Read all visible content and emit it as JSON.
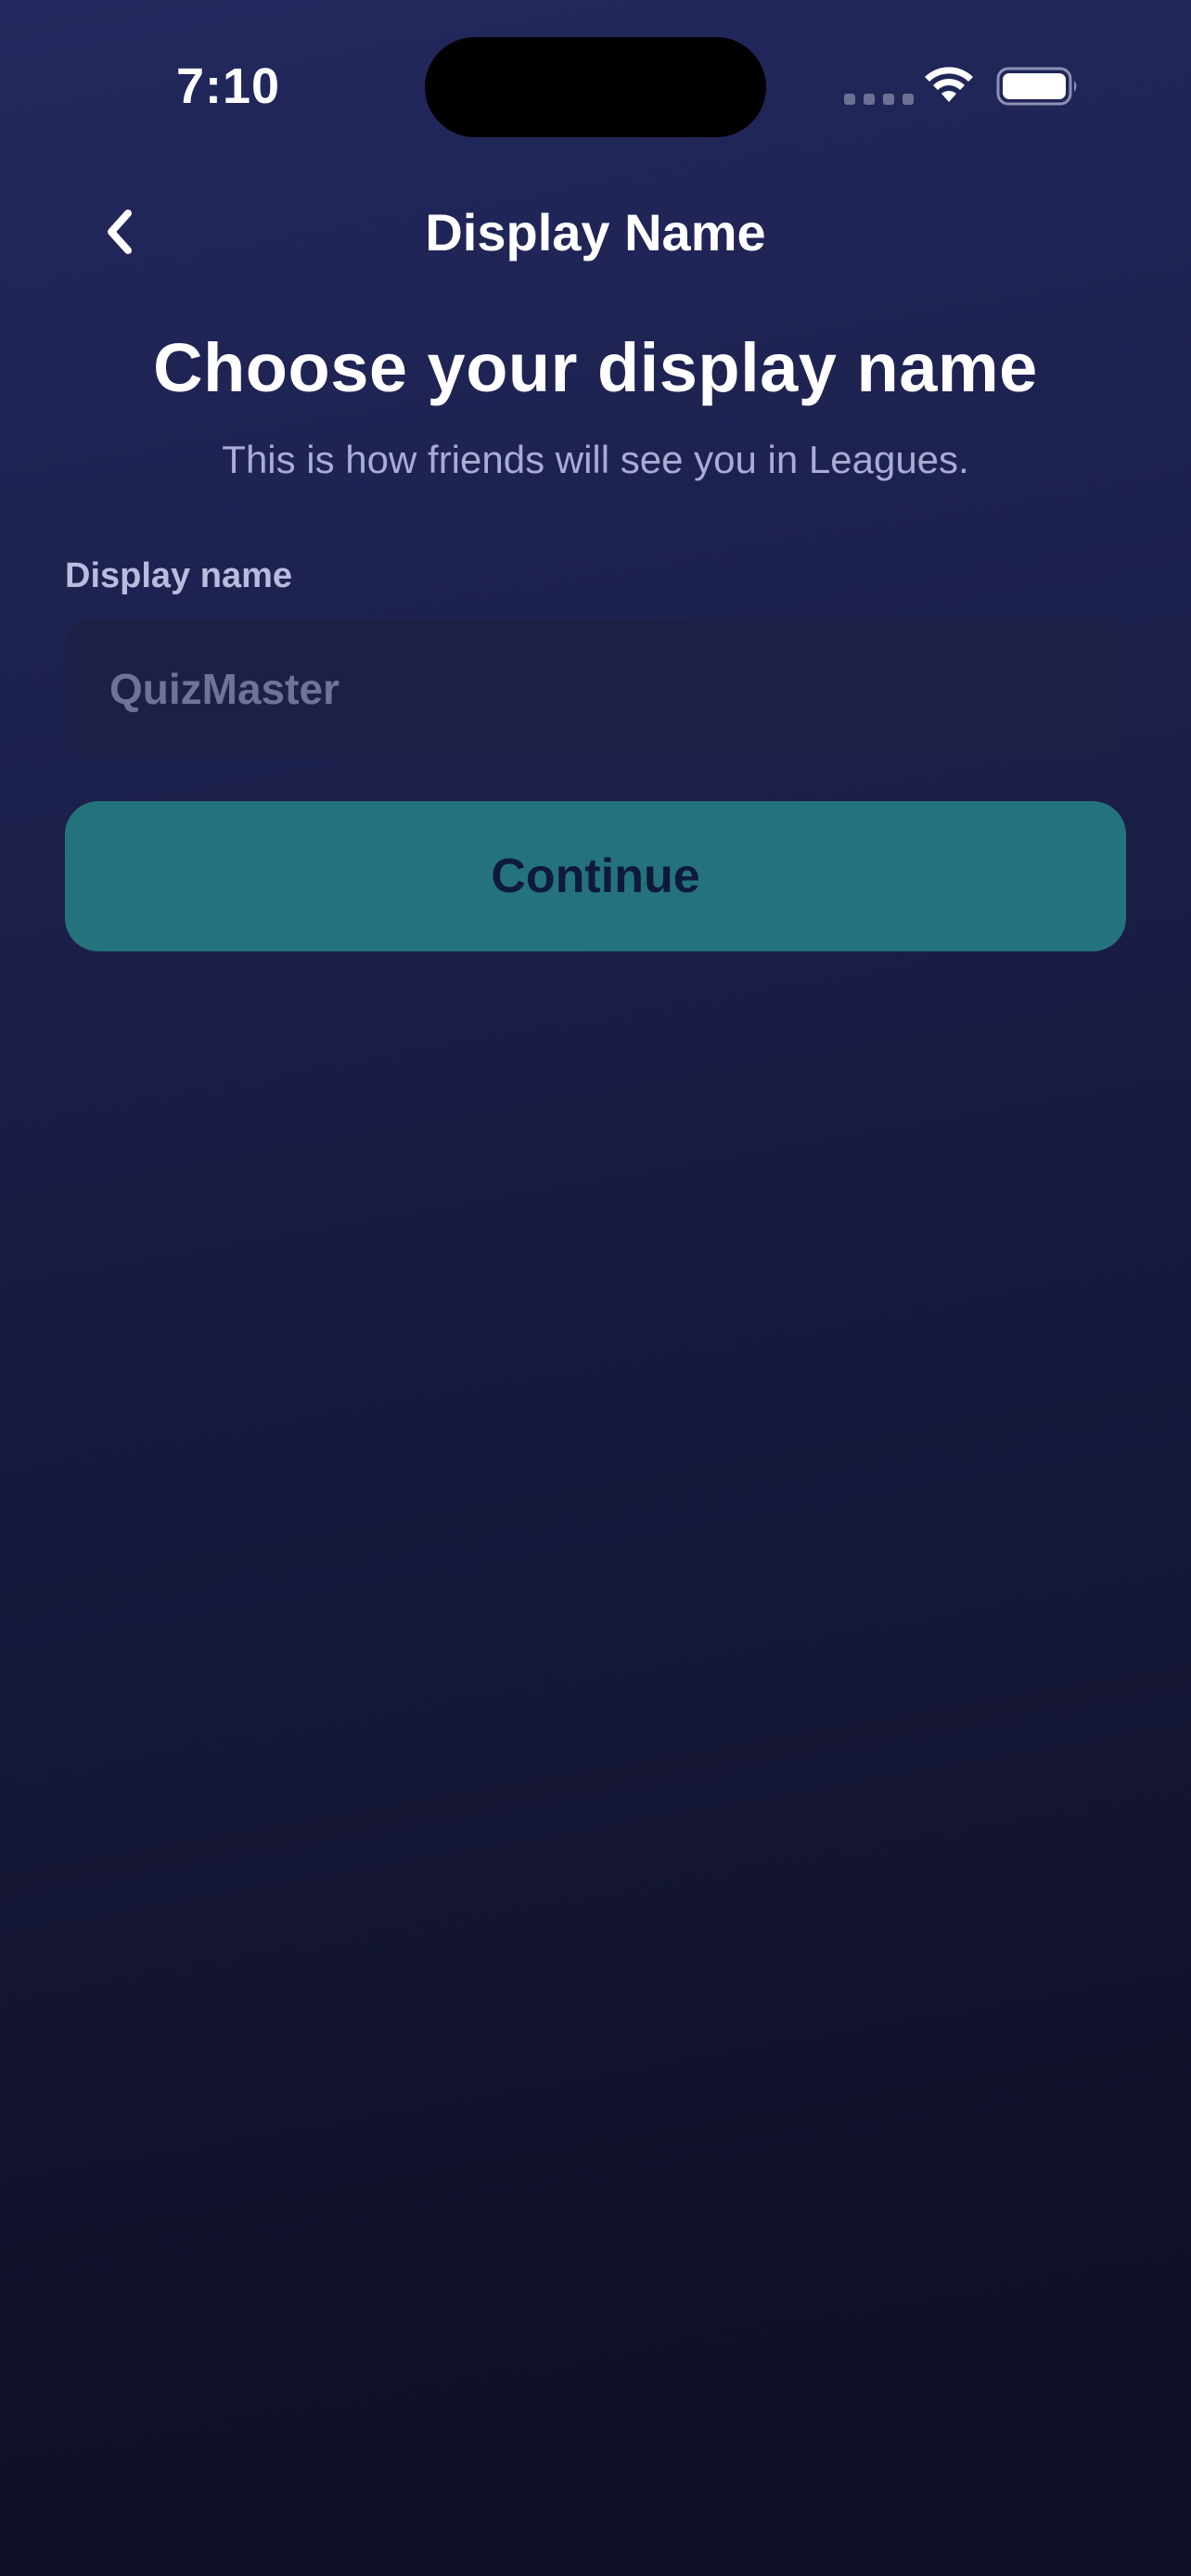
{
  "status_bar": {
    "time": "7:10",
    "wifi_icon": "wifi-icon",
    "battery_icon": "battery-icon",
    "signal_icon": "cellular-dots-icon"
  },
  "nav": {
    "back_icon": "chevron-left-icon",
    "title": "Display Name"
  },
  "header": {
    "title": "Choose your display name",
    "subtitle": "This is how friends will see you in Leagues."
  },
  "form": {
    "label": "Display name",
    "value": "",
    "placeholder": "QuizMaster"
  },
  "actions": {
    "continue_label": "Continue"
  },
  "colors": {
    "background_top": "#23285e",
    "background_bottom": "#0d0f24",
    "input_background": "#1d2046",
    "button_accent": "#24737c",
    "button_text": "#0f1a3a",
    "subtitle_text": "#a9acd4"
  }
}
